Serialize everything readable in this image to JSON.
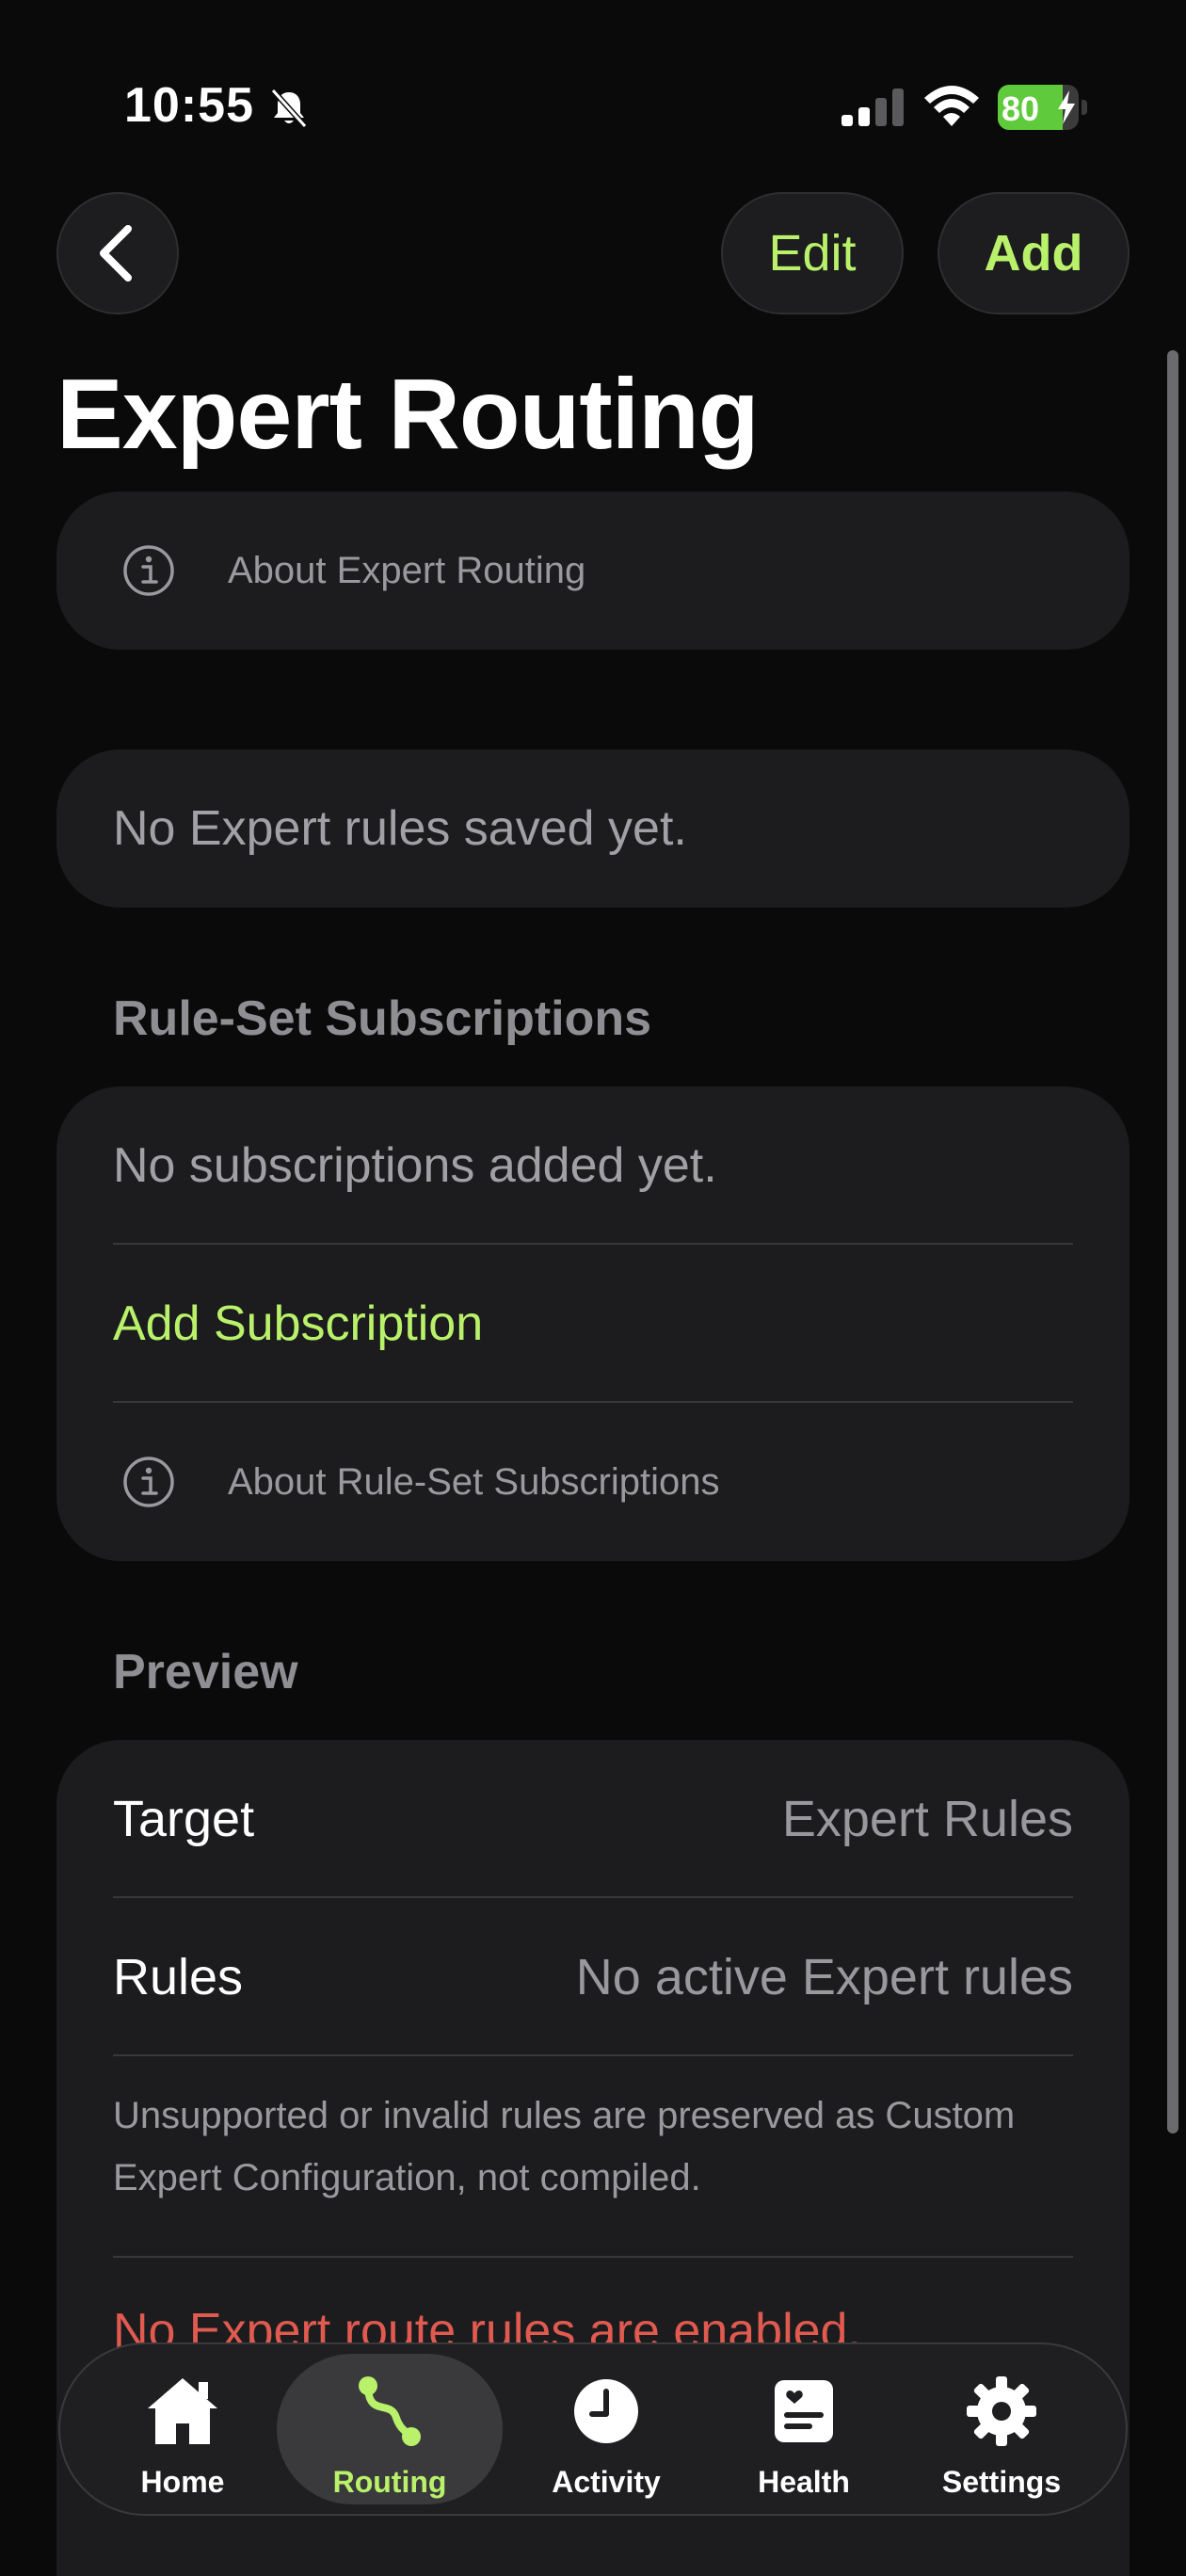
{
  "status_bar": {
    "time": "10:55",
    "battery": "80",
    "battery_level": 0.8
  },
  "nav": {
    "back_icon": "chevron-left-icon",
    "edit_label": "Edit",
    "add_label": "Add"
  },
  "page_title": "Expert Routing",
  "about_card": {
    "icon": "info-icon",
    "label": "About Expert Routing"
  },
  "empty_rules": "No Expert rules saved yet.",
  "subscriptions": {
    "header": "Rule-Set Subscriptions",
    "empty": "No subscriptions added yet.",
    "add_label": "Add Subscription",
    "about_label": "About Rule-Set Subscriptions"
  },
  "preview": {
    "header": "Preview",
    "rows": [
      {
        "key": "Target",
        "value": "Expert Rules"
      },
      {
        "key": "Rules",
        "value": "No active Expert rules"
      }
    ],
    "note": "Unsupported or invalid rules are preserved as Custom Expert Configuration, not compiled.",
    "warning": "No Expert route rules are enabled."
  },
  "tabs": [
    {
      "label": "Home",
      "icon": "house-icon"
    },
    {
      "label": "Routing",
      "icon": "route-icon",
      "active": true
    },
    {
      "label": "Activity",
      "icon": "clock-icon"
    },
    {
      "label": "Health",
      "icon": "health-card-icon"
    },
    {
      "label": "Settings",
      "icon": "gear-icon"
    }
  ],
  "colors": {
    "accent": "#b9f26a",
    "warning": "#e05a4f",
    "background": "#0a0a0a",
    "card": "#1c1c1e"
  }
}
